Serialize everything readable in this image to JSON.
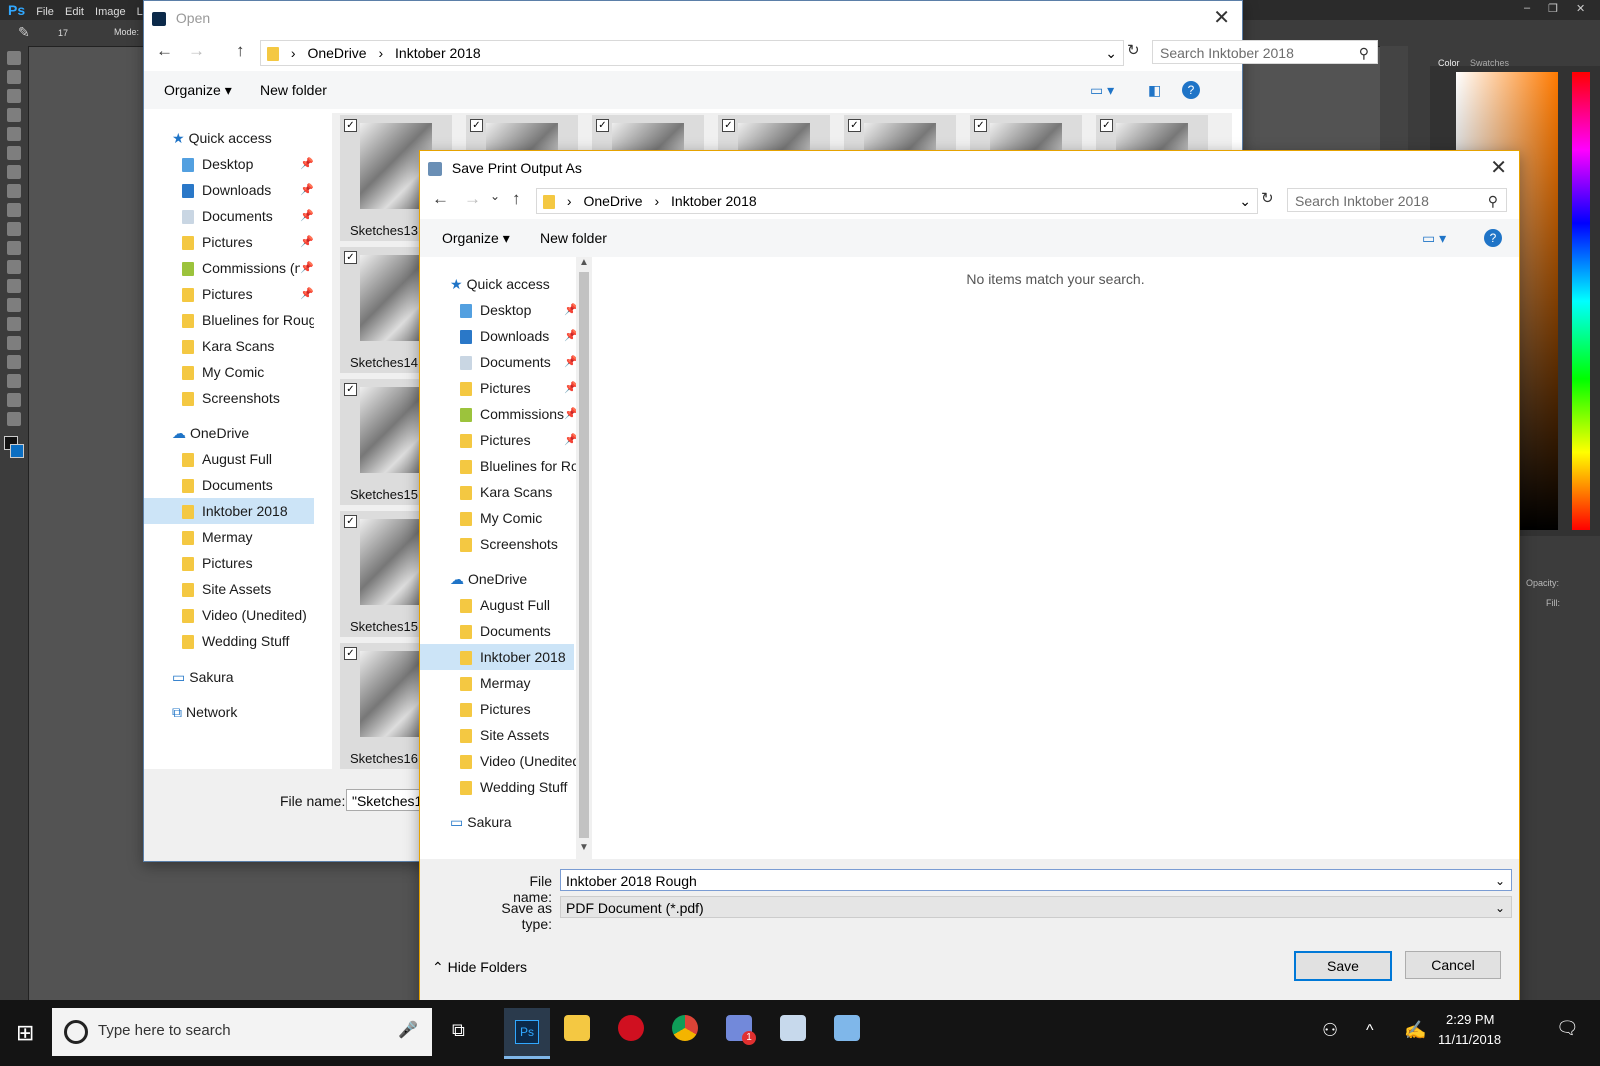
{
  "photoshop": {
    "menus": [
      "Ps",
      "File",
      "Edit",
      "Image",
      "Laye"
    ],
    "options": {
      "brush_size": "17",
      "mode_label": "Mode:"
    },
    "panel_tabs": [
      "Color",
      "Swatches"
    ],
    "layers": {
      "opacity_label": "Opacity:",
      "fill_label": "Fill:"
    }
  },
  "open_dialog": {
    "title": "Open",
    "breadcrumb": [
      "OneDrive",
      "Inktober 2018"
    ],
    "search_placeholder": "Search Inktober 2018",
    "organize": "Organize",
    "new_folder": "New folder",
    "nav": {
      "quick_access": "Quick access",
      "quick_items": [
        {
          "label": "Desktop",
          "pinned": true
        },
        {
          "label": "Downloads",
          "pinned": true
        },
        {
          "label": "Documents",
          "pinned": true
        },
        {
          "label": "Pictures",
          "pinned": true
        },
        {
          "label": "Commissions (nc",
          "pinned": true
        },
        {
          "label": "Pictures",
          "pinned": true
        },
        {
          "label": "Bluelines for Roughs",
          "pinned": false
        },
        {
          "label": "Kara Scans",
          "pinned": false
        },
        {
          "label": "My Comic",
          "pinned": false
        },
        {
          "label": "Screenshots",
          "pinned": false
        }
      ],
      "onedrive": "OneDrive",
      "onedrive_items": [
        "August Full",
        "Documents",
        "Inktober 2018",
        "Mermay",
        "Pictures",
        "Site Assets",
        "Video (Unedited)",
        "Wedding Stuff"
      ],
      "selected": "Inktober 2018",
      "sakura": "Sakura",
      "network": "Network"
    },
    "thumb_captions": [
      "Sketches13",
      "Sketches14",
      "Sketches15",
      "Sketches15",
      "Sketches16"
    ],
    "file_name_label": "File name:",
    "file_name_value": "\"Sketches1"
  },
  "save_dialog": {
    "title": "Save Print Output As",
    "breadcrumb": [
      "OneDrive",
      "Inktober 2018"
    ],
    "search_placeholder": "Search Inktober 2018",
    "organize": "Organize",
    "new_folder": "New folder",
    "empty_message": "No items match your search.",
    "nav": {
      "quick_access": "Quick access",
      "quick_items": [
        {
          "label": "Desktop",
          "pinned": true
        },
        {
          "label": "Downloads",
          "pinned": true
        },
        {
          "label": "Documents",
          "pinned": true
        },
        {
          "label": "Pictures",
          "pinned": true
        },
        {
          "label": "Commissions",
          "pinned": true
        },
        {
          "label": "Pictures",
          "pinned": true
        },
        {
          "label": "Bluelines for Rou",
          "pinned": false
        },
        {
          "label": "Kara Scans",
          "pinned": false
        },
        {
          "label": "My Comic",
          "pinned": false
        },
        {
          "label": "Screenshots",
          "pinned": false
        }
      ],
      "onedrive": "OneDrive",
      "onedrive_items": [
        "August Full",
        "Documents",
        "Inktober 2018",
        "Mermay",
        "Pictures",
        "Site Assets",
        "Video (Unedited)",
        "Wedding Stuff"
      ],
      "selected": "Inktober 2018",
      "sakura": "Sakura"
    },
    "file_name_label": "File name:",
    "file_name_value": "Inktober 2018 Rough",
    "save_type_label": "Save as type:",
    "save_type_value": "PDF Document (*.pdf)",
    "hide_folders": "Hide Folders",
    "save_button": "Save",
    "cancel_button": "Cancel"
  },
  "taskbar": {
    "search_placeholder": "Type here to search",
    "time": "2:29 PM",
    "date": "11/11/2018",
    "discord_badge": "1"
  },
  "colors": {
    "accent": "#0078d7",
    "selection": "#cce4f7",
    "folder": "#f4c842",
    "photoshop_bg": "#535353"
  }
}
